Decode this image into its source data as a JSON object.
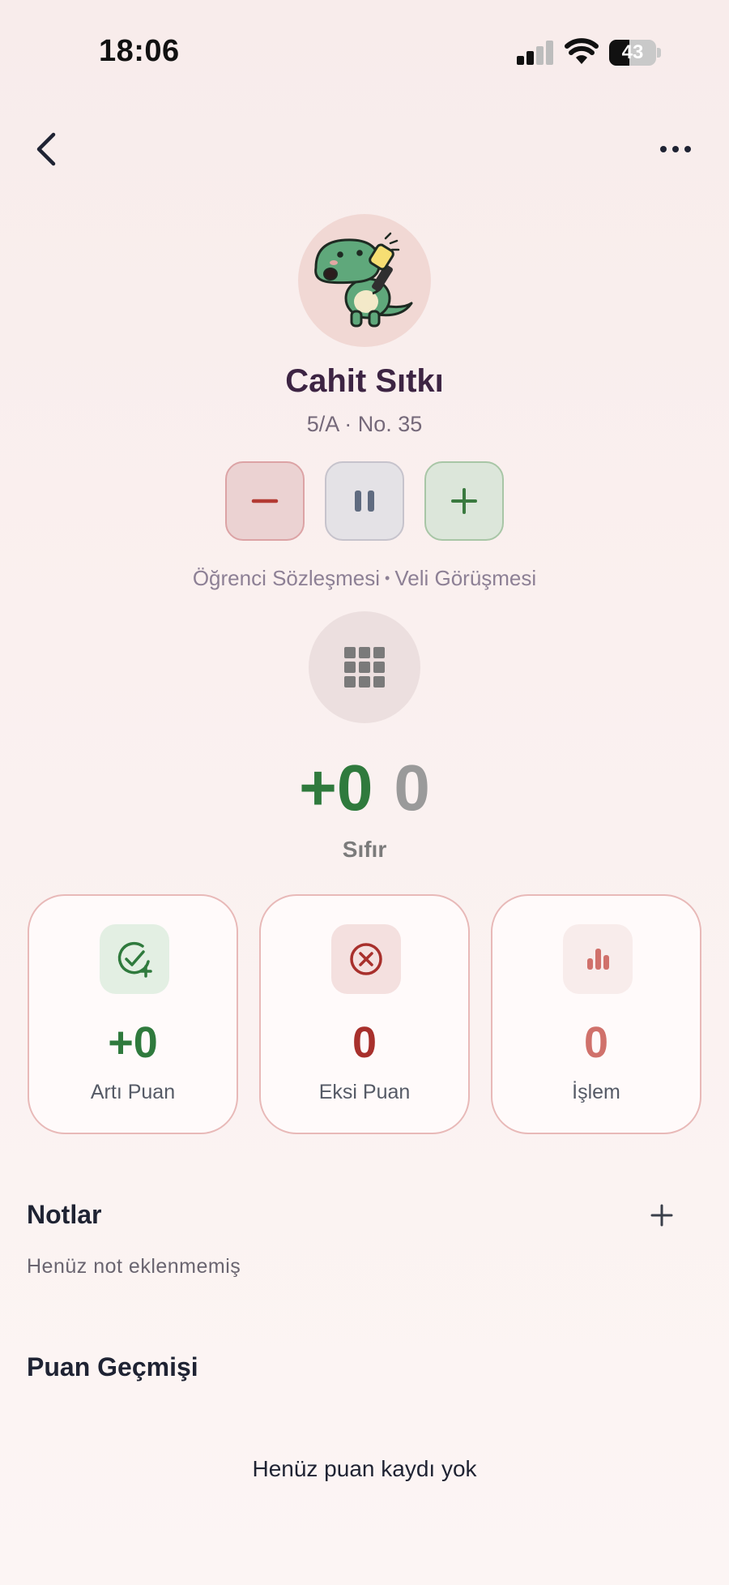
{
  "status_bar": {
    "time": "18:06",
    "battery_level": "43",
    "icons": [
      "cellular-signal-icon",
      "wifi-icon",
      "battery-icon"
    ]
  },
  "nav": {
    "back_icon": "chevron-left-icon",
    "more_icon": "more-horizontal-icon"
  },
  "student": {
    "name": "Cahit Sıtkı",
    "meta": "5/A · No. 35",
    "avatar_icon": "dinosaur-avatar"
  },
  "actions": [
    {
      "icon": "minus-icon",
      "color": "#b33a33"
    },
    {
      "icon": "pause-icon",
      "color": "#5f6b80"
    },
    {
      "icon": "plus-icon",
      "color": "#3a7a3f"
    }
  ],
  "tags": [
    "Öğrenci Sözleşmesi",
    "Veli Görüşmesi"
  ],
  "tag_separator": "•",
  "grid_icon": "grid-icon",
  "score": {
    "plus": "+0",
    "total": "0",
    "label": "Sıfır"
  },
  "cards": [
    {
      "value": "+0",
      "label": "Artı Puan",
      "icon": "check-circle-plus-icon",
      "color": "#2f7a3d",
      "icon_bg": "#e3efe3"
    },
    {
      "value": "0",
      "label": "Eksi Puan",
      "icon": "x-circle-icon",
      "color": "#a8302c",
      "icon_bg": "#f4e0df"
    },
    {
      "value": "0",
      "label": "İşlem",
      "icon": "bar-chart-icon",
      "color": "#d0716b",
      "icon_bg": "#f8eceb"
    }
  ],
  "notes": {
    "title": "Notlar",
    "add_icon": "plus-icon",
    "empty": "Henüz not eklenmemiş"
  },
  "history": {
    "title": "Puan Geçmişi",
    "empty": "Henüz puan kaydı yok"
  }
}
